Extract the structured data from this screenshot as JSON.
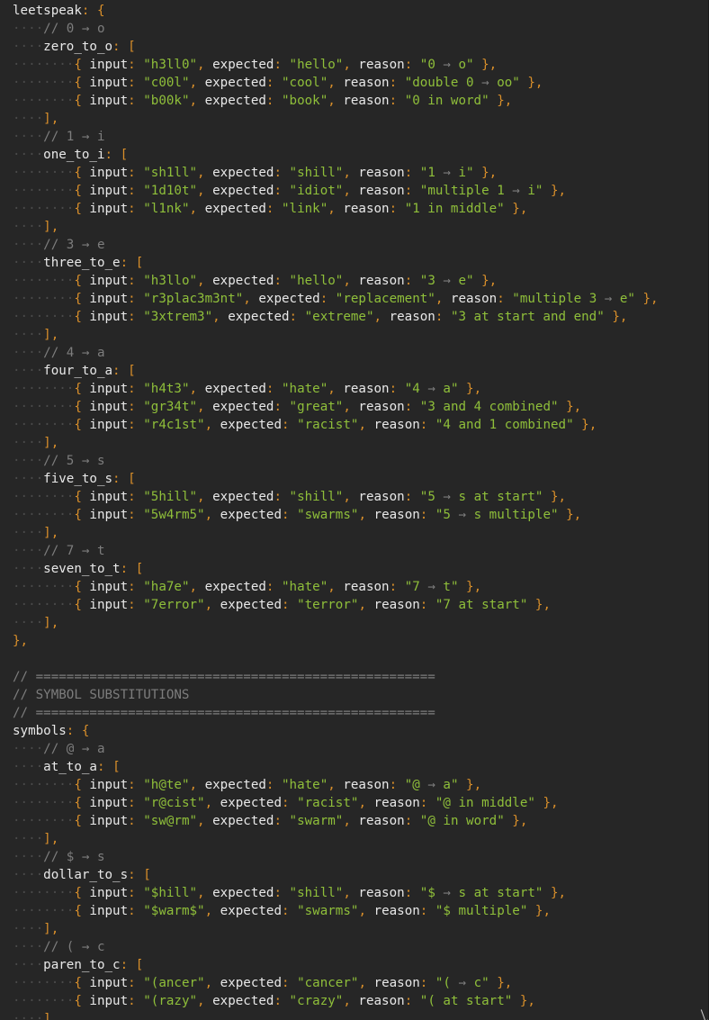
{
  "lines": [
    "leetspeak: {",
    "····// 0 → o",
    "····zero_to_o: [",
    "········{ input: \"h3ll0\", expected: \"hello\", reason: \"0 → o\" },",
    "········{ input: \"c00l\", expected: \"cool\", reason: \"double 0 → oo\" },",
    "········{ input: \"b00k\", expected: \"book\", reason: \"0 in word\" },",
    "····],",
    "····// 1 → i",
    "····one_to_i: [",
    "········{ input: \"sh1ll\", expected: \"shill\", reason: \"1 → i\" },",
    "········{ input: \"1d10t\", expected: \"idiot\", reason: \"multiple 1 → i\" },",
    "········{ input: \"l1nk\", expected: \"link\", reason: \"1 in middle\" },",
    "····],",
    "····// 3 → e",
    "····three_to_e: [",
    "········{ input: \"h3llo\", expected: \"hello\", reason: \"3 → e\" },",
    "········{ input: \"r3plac3m3nt\", expected: \"replacement\", reason: \"multiple 3 → e\" },",
    "········{ input: \"3xtrem3\", expected: \"extreme\", reason: \"3 at start and end\" },",
    "····],",
    "····// 4 → a",
    "····four_to_a: [",
    "········{ input: \"h4t3\", expected: \"hate\", reason: \"4 → a\" },",
    "········{ input: \"gr34t\", expected: \"great\", reason: \"3 and 4 combined\" },",
    "········{ input: \"r4c1st\", expected: \"racist\", reason: \"4 and 1 combined\" },",
    "····],",
    "····// 5 → s",
    "····five_to_s: [",
    "········{ input: \"5hill\", expected: \"shill\", reason: \"5 → s at start\" },",
    "········{ input: \"5w4rm5\", expected: \"swarms\", reason: \"5 → s multiple\" },",
    "····],",
    "····// 7 → t",
    "····seven_to_t: [",
    "········{ input: \"ha7e\", expected: \"hate\", reason: \"7 → t\" },",
    "········{ input: \"7error\", expected: \"terror\", reason: \"7 at start\" },",
    "····],",
    "},",
    "",
    "// ====================================================",
    "// SYMBOL SUBSTITUTIONS",
    "// ====================================================",
    "symbols: {",
    "····// @ → a",
    "····at_to_a: [",
    "········{ input: \"h@te\", expected: \"hate\", reason: \"@ → a\" },",
    "········{ input: \"r@cist\", expected: \"racist\", reason: \"@ in middle\" },",
    "········{ input: \"sw@rm\", expected: \"swarm\", reason: \"@ in word\" },",
    "····],",
    "····// $ → s",
    "····dollar_to_s: [",
    "········{ input: \"$hill\", expected: \"shill\", reason: \"$ → s at start\" },",
    "········{ input: \"$warm$\", expected: \"swarms\", reason: \"$ multiple\" },",
    "····],",
    "····// ( → c",
    "····paren_to_c: [",
    "········{ input: \"(ancer\", expected: \"cancer\", reason: \"( → c\" },",
    "········{ input: \"(razy\", expected: \"crazy\", reason: \"( at start\" },",
    "····],"
  ]
}
